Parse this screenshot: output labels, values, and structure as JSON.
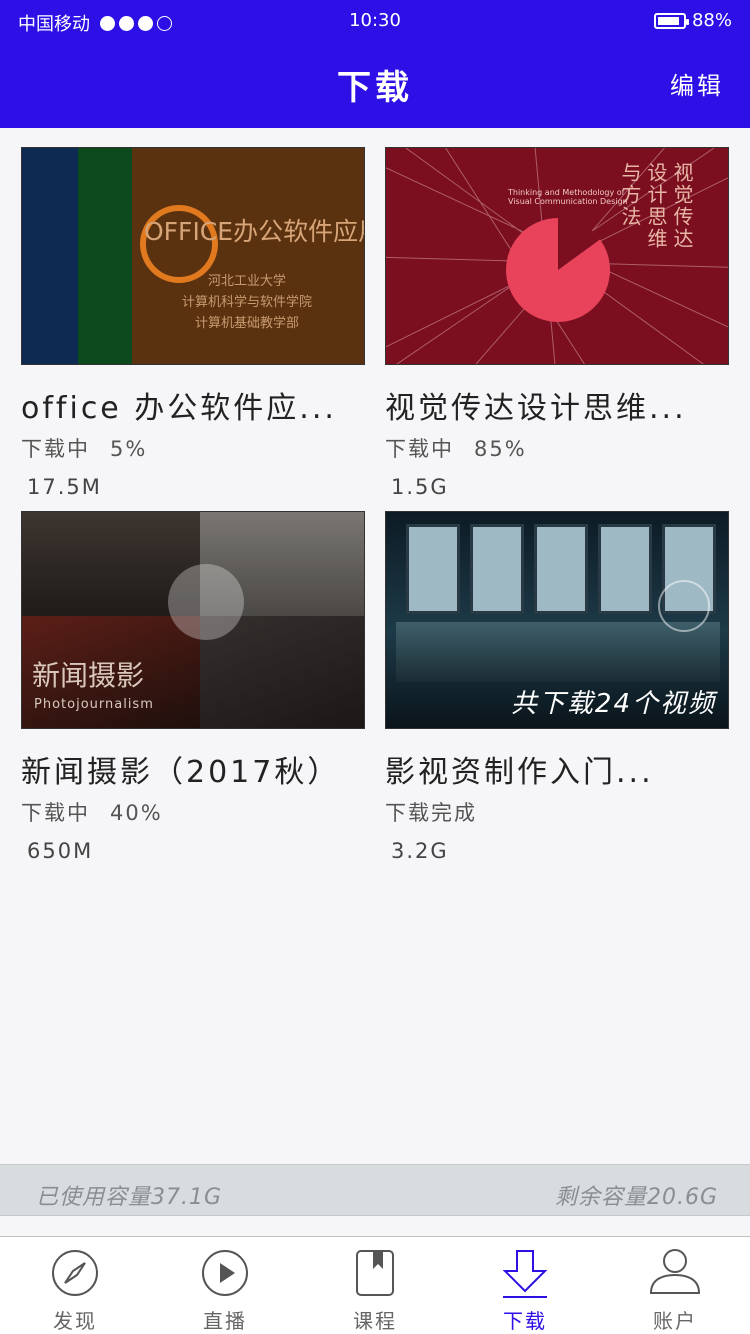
{
  "status_bar": {
    "carrier": "中国移动",
    "time": "10:30",
    "battery": "88%",
    "battery_level": 0.88
  },
  "header": {
    "title": "下载",
    "edit_label": "编辑"
  },
  "items": [
    {
      "name": "office 办公软件应...",
      "status": "下载中",
      "progress": "5%",
      "size": "17.5M",
      "thumb": {
        "title": "OFFICE办公软件应用",
        "lines": [
          "河北工业大学",
          "计算机科学与软件学院",
          "计算机基础教学部"
        ]
      }
    },
    {
      "name": "视觉传达设计思维...",
      "status": "下载中",
      "progress": "85%",
      "size": "1.5G",
      "thumb": {
        "vertical_cols": [
          "视觉传达",
          "设计思维",
          "与方法"
        ],
        "subtitle_en": "Thinking and Methodology of Visual Communication Design"
      }
    },
    {
      "name": "新闻摄影（2017秋）",
      "status": "下载中",
      "progress": "40%",
      "size": "650M",
      "thumb": {
        "title": "新闻摄影",
        "subtitle": "Photojournalism"
      }
    },
    {
      "name": "影视资制作入门...",
      "status": "下载完成",
      "progress": "",
      "size": "3.2G",
      "thumb": {
        "overlay": "共下载24个视频"
      }
    }
  ],
  "storage": {
    "used": "已使用容量37.1G",
    "remaining": "剩余容量20.6G"
  },
  "tabs": [
    {
      "label": "发现",
      "icon": "compass-icon",
      "active": false
    },
    {
      "label": "直播",
      "icon": "play-icon",
      "active": false
    },
    {
      "label": "课程",
      "icon": "book-icon",
      "active": false
    },
    {
      "label": "下载",
      "icon": "download-icon",
      "active": true
    },
    {
      "label": "账户",
      "icon": "user-icon",
      "active": false
    }
  ],
  "colors": {
    "accent": "#2c10e6",
    "background": "#f6f6f8"
  }
}
